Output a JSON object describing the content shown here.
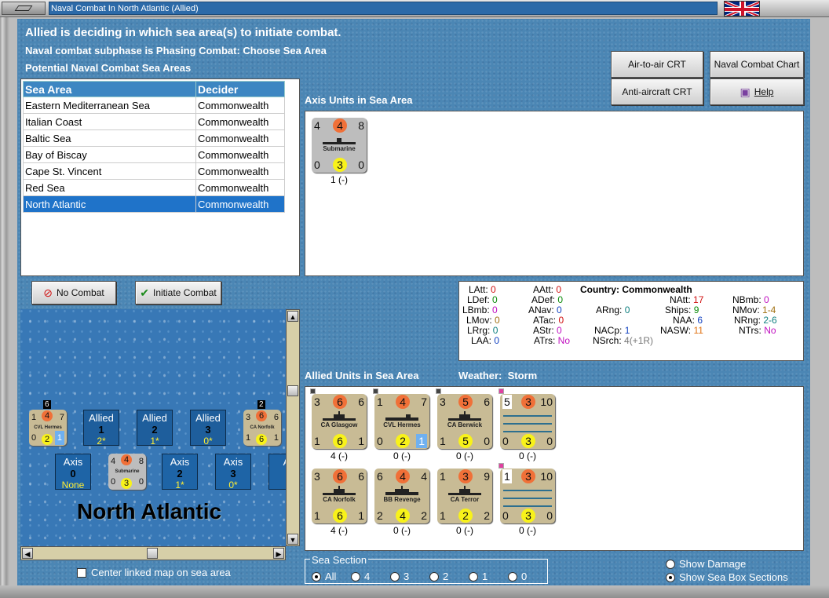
{
  "window": {
    "title": "Naval Combat In North Atlantic (Allied)"
  },
  "header": {
    "line1": "Allied is deciding in which sea area(s) to initiate combat.",
    "line2": "Naval combat subphase is Phasing Combat: Choose Sea Area",
    "line3": "Potential Naval Combat Sea Areas"
  },
  "buttons": {
    "air_to_air": "Air-to-air CRT",
    "naval_chart": "Naval Combat Chart",
    "anti_aircraft": "Anti-aircraft CRT",
    "help": "Help",
    "no_combat": "No Combat",
    "initiate_combat": "Initiate Combat"
  },
  "sea_table": {
    "headers": [
      "Sea Area",
      "Decider"
    ],
    "rows": [
      [
        "Eastern Mediterranean Sea",
        "Commonwealth"
      ],
      [
        "Italian Coast",
        "Commonwealth"
      ],
      [
        "Baltic Sea",
        "Commonwealth"
      ],
      [
        "Bay of Biscay",
        "Commonwealth"
      ],
      [
        "Cape St. Vincent",
        "Commonwealth"
      ],
      [
        "Red Sea",
        "Commonwealth"
      ],
      [
        "North Atlantic",
        "Commonwealth"
      ]
    ]
  },
  "axis_units": {
    "label": "Axis Units in Sea Area",
    "units": [
      {
        "tl": "4",
        "tm": "4",
        "tr": "8",
        "name": "Submarine",
        "bl": "0",
        "bm": "3",
        "br": "0",
        "caption": "1 (-)"
      }
    ]
  },
  "stats": {
    "country_label": "Country:",
    "country": "Commonwealth",
    "items": {
      "LAtt": "0",
      "LDef": "0",
      "LBmb": "0",
      "LMov": "0",
      "LRrg": "0",
      "LAA": "0",
      "AAtt": "0",
      "ADef": "0",
      "ANav": "0",
      "ATac": "0",
      "AStr": "0",
      "ATrs": "No",
      "ARng": "0",
      "NACp": "1",
      "NSrch": "4(+1R)",
      "NAtt": "17",
      "Ships": "9",
      "NAA": "6",
      "NASW": "11",
      "NBmb": "0",
      "NMov": "1-4",
      "NRng": "2-6",
      "NTrs": "No"
    }
  },
  "allied_units": {
    "label": "Allied Units in Sea Area",
    "weather_label": "Weather:",
    "weather": "Storm",
    "units": [
      {
        "tl": "3",
        "tm": "6",
        "tr": "6",
        "name": "CA Glasgow",
        "bl": "1",
        "bm": "6",
        "br": "1",
        "caption": "4 (-)"
      },
      {
        "tl": "1",
        "tm": "4",
        "tr": "7",
        "name": "CVL Hermes",
        "bl": "0",
        "bm": "2",
        "br": "1",
        "caption": "0 (-)"
      },
      {
        "tl": "3",
        "tm": "5",
        "tr": "6",
        "name": "CA Berwick",
        "bl": "1",
        "bm": "5",
        "br": "0",
        "caption": "0 (-)"
      },
      {
        "tl": "5",
        "tm": "3",
        "tr": "10",
        "name": "",
        "bl": "0",
        "bm": "3",
        "br": "0",
        "caption": "0 (-)"
      },
      {
        "tl": "3",
        "tm": "6",
        "tr": "6",
        "name": "CA Norfolk",
        "bl": "1",
        "bm": "6",
        "br": "1",
        "caption": "4 (-)"
      },
      {
        "tl": "6",
        "tm": "4",
        "tr": "4",
        "name": "BB Revenge",
        "bl": "2",
        "bm": "4",
        "br": "2",
        "caption": "0 (-)"
      },
      {
        "tl": "1",
        "tm": "3",
        "tr": "9",
        "name": "CA Terror",
        "bl": "1",
        "bm": "2",
        "br": "2",
        "caption": "0 (-)"
      },
      {
        "tl": "1",
        "tm": "3",
        "tr": "10",
        "name": "",
        "bl": "0",
        "bm": "3",
        "br": "0",
        "caption": "0 (-)"
      }
    ]
  },
  "map": {
    "title": "North Atlantic",
    "counters": [
      {
        "stack": "6",
        "tl": "1",
        "tm": "4",
        "tr": "7",
        "name": "CVL Hermes",
        "bl": "0",
        "bm": "2",
        "br": "1"
      },
      {
        "stack": "2",
        "tl": "3",
        "tm": "6",
        "tr": "6",
        "name": "CA Norfolk",
        "bl": "1",
        "bm": "6",
        "br": "1"
      },
      {
        "stack": "",
        "tl": "4",
        "tm": "4",
        "tr": "8",
        "name": "Submarine",
        "bl": "0",
        "bm": "3",
        "br": "0"
      }
    ],
    "allied_boxes": [
      {
        "side": "Allied",
        "num": "1",
        "val": "2*"
      },
      {
        "side": "Allied",
        "num": "2",
        "val": "1*"
      },
      {
        "side": "Allied",
        "num": "3",
        "val": "0*"
      }
    ],
    "axis_boxes": [
      {
        "side": "Axis",
        "num": "0",
        "val": "None"
      },
      {
        "side": "Axis",
        "num": "2",
        "val": "1*"
      },
      {
        "side": "Axis",
        "num": "3",
        "val": "0*"
      },
      {
        "side": "A",
        "num": "",
        "val": ""
      }
    ]
  },
  "controls": {
    "center_linked": "Center linked map on sea area",
    "sea_section_label": "Sea Section",
    "sea_sections": [
      "All",
      "4",
      "3",
      "2",
      "1",
      "0"
    ],
    "show_damage": "Show Damage",
    "show_sea_box": "Show Sea Box Sections"
  }
}
